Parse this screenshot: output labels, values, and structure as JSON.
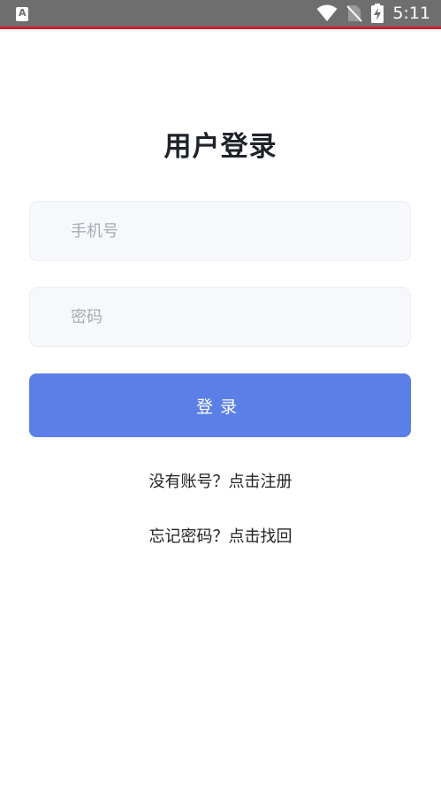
{
  "status_bar": {
    "time": "5:11",
    "app_icon": "a-icon",
    "icons": [
      "wifi-icon",
      "no-sim-icon",
      "battery-charging-icon"
    ]
  },
  "page": {
    "title": "用户登录"
  },
  "form": {
    "phone_placeholder": "手机号",
    "password_placeholder": "密码",
    "login_label": "登录"
  },
  "links": {
    "register": "没有账号？点击注册",
    "forgot": "忘记密码？点击找回"
  },
  "colors": {
    "status_bar_bg": "#6e6e6e",
    "status_bar_accent": "#d21f2b",
    "primary_button": "#5b7fe6",
    "input_bg": "#f6f8fb"
  }
}
